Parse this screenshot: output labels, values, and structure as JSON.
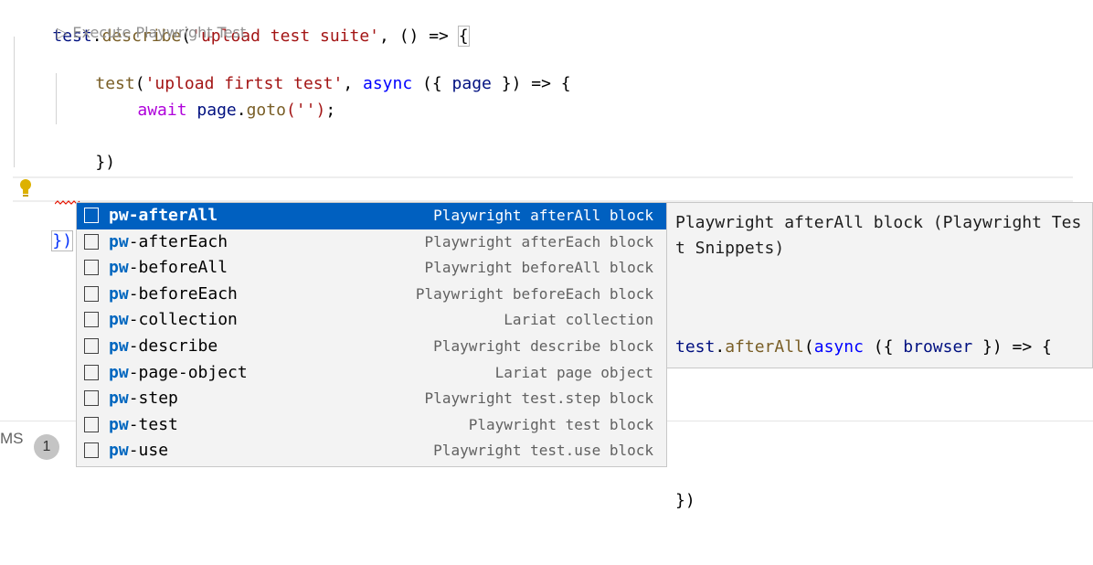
{
  "editor": {
    "line1": {
      "obj": "test",
      "dot": ".",
      "method": "describe",
      "open": "(",
      "str": "'upload test suite'",
      "comma": ", ",
      "arrow_params": "() => ",
      "brace": "{"
    },
    "codelens": "▷ Execute Playwright Test",
    "line2": {
      "fn": "test",
      "open": "(",
      "str": "'upload firtst test'",
      "comma": ", ",
      "async": "async",
      "space": " ",
      "params": "({ ",
      "param": "page",
      "params_close": " }) => {"
    },
    "line3": {
      "await": "await",
      "space": " ",
      "obj": "page",
      "dot": ".",
      "method": "goto",
      "args": "('')",
      "semi": ";"
    },
    "line5": {
      "text": "})"
    },
    "line7": {
      "text": "pw"
    },
    "line8": {
      "text": "})"
    }
  },
  "icons": {
    "lightbulb": "lightbulb-icon",
    "snippet": "snippet-icon"
  },
  "suggest": {
    "query": "pw",
    "items": [
      {
        "label": "afterAll",
        "detail": "Playwright afterAll block"
      },
      {
        "label": "afterEach",
        "detail": "Playwright afterEach block"
      },
      {
        "label": "beforeAll",
        "detail": "Playwright beforeAll block"
      },
      {
        "label": "beforeEach",
        "detail": "Playwright beforeEach block"
      },
      {
        "label": "collection",
        "detail": "Lariat collection"
      },
      {
        "label": "describe",
        "detail": "Playwright describe block"
      },
      {
        "label": "page-object",
        "detail": "Lariat page object"
      },
      {
        "label": "step",
        "detail": "Playwright test.step block"
      },
      {
        "label": "test",
        "detail": "Playwright test block"
      },
      {
        "label": "use",
        "detail": "Playwright test.use block"
      }
    ],
    "prefix": "pw-"
  },
  "details": {
    "description": "Playwright afterAll block (Playwright Test Snippets)",
    "code_obj": "test",
    "code_dot": ".",
    "code_method": "afterAll",
    "code_open": "(",
    "code_async": "async",
    "code_space": " ",
    "code_params": "({ ",
    "code_param": "browser",
    "code_close": " }) => {",
    "code_end": "})"
  },
  "status": {
    "label": "MS",
    "badge": "1"
  },
  "colors": {
    "selection": "#0060c0",
    "match": "#0066bf",
    "widget_bg": "#f3f3f3"
  }
}
